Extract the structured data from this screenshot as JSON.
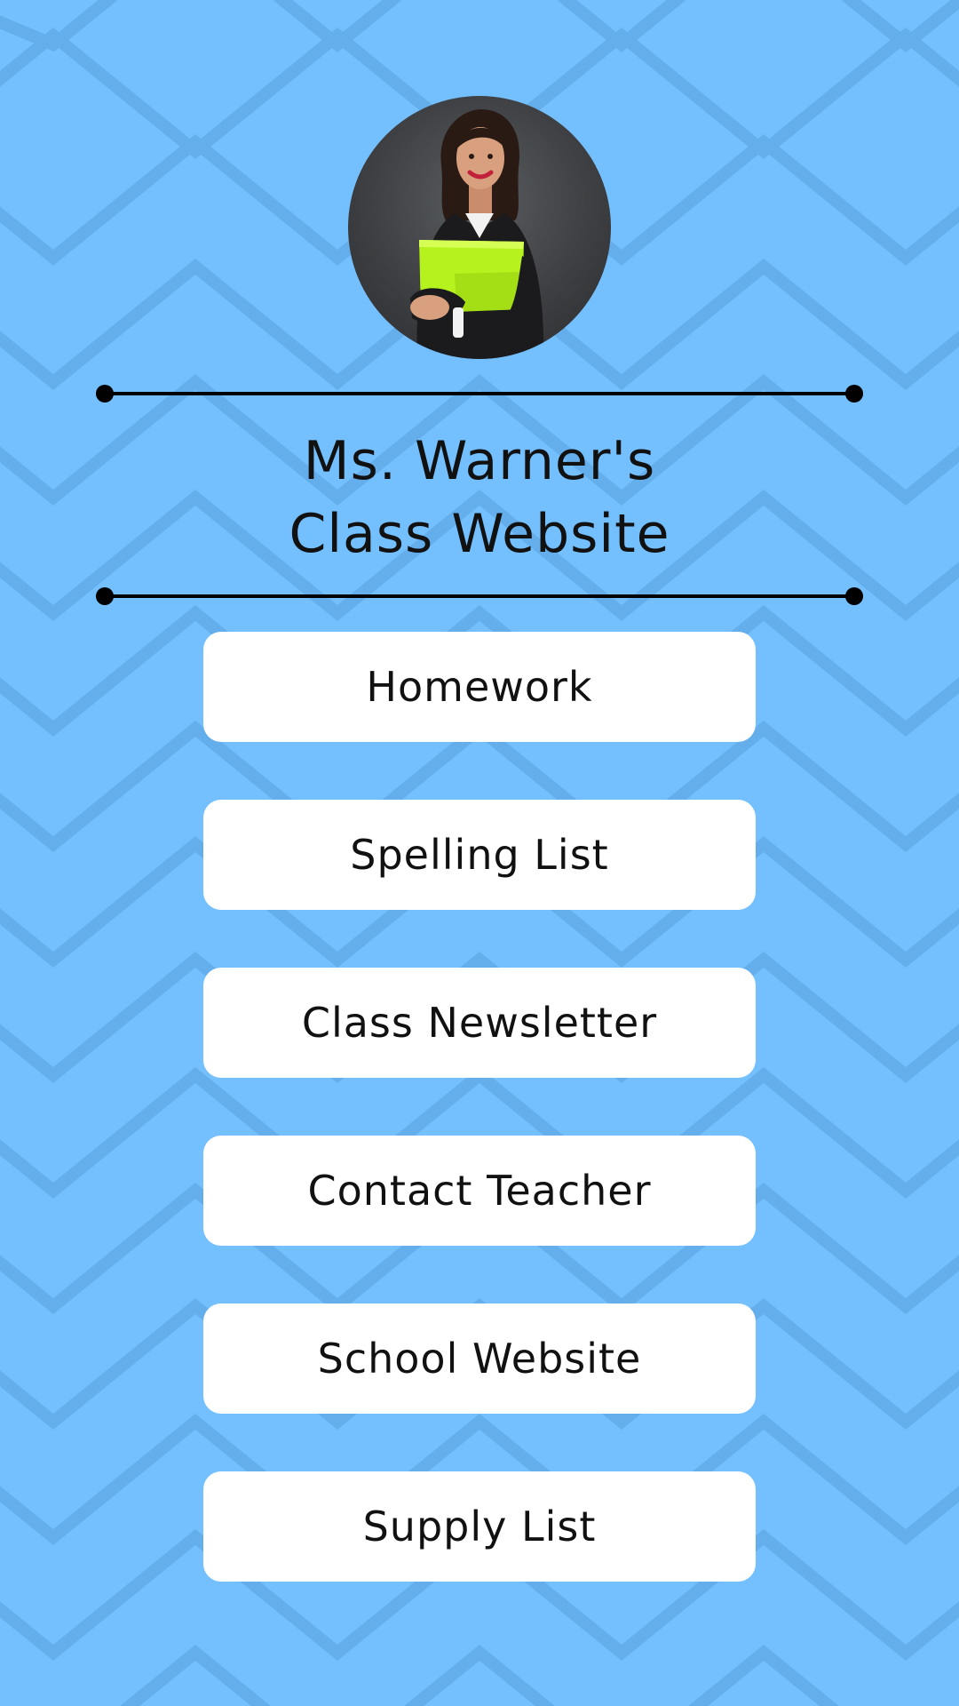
{
  "colors": {
    "background": "#74bffd",
    "pattern": "#64aeeb",
    "button_bg": "#ffffff",
    "text": "#111111",
    "folder": "#b6f21e"
  },
  "header": {
    "avatar_icon": "teacher-photo",
    "title_line1": "Ms. Warner's",
    "title_line2": "Class Website"
  },
  "nav": {
    "items": [
      {
        "label": "Homework"
      },
      {
        "label": "Spelling List"
      },
      {
        "label": "Class Newsletter"
      },
      {
        "label": "Contact Teacher"
      },
      {
        "label": "School Website"
      },
      {
        "label": "Supply List"
      }
    ]
  }
}
